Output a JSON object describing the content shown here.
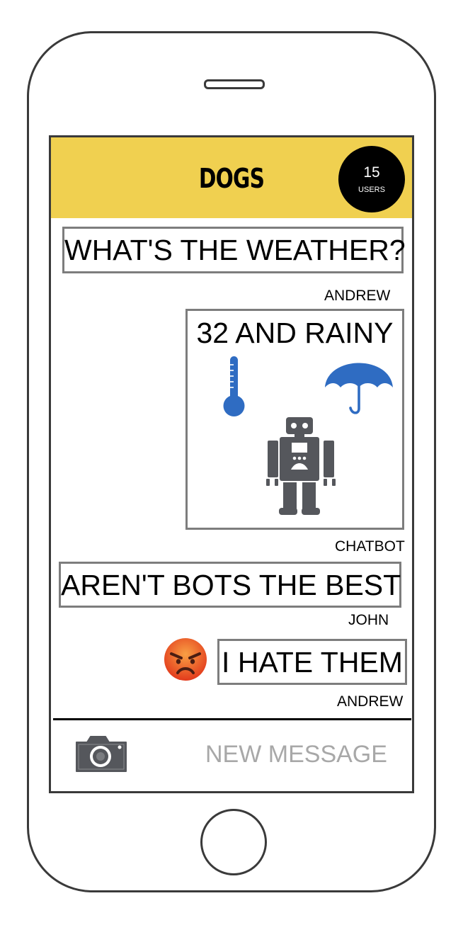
{
  "header": {
    "title": "DOGS",
    "users_count": "15",
    "users_label": "USERS",
    "background_color": "#f0d050"
  },
  "messages": [
    {
      "text": "WHAT'S THE WEATHER?",
      "sender": "ANDREW"
    },
    {
      "text": "32 AND RAINY",
      "sender": "CHATBOT",
      "icons": [
        "thermometer-icon",
        "umbrella-icon",
        "robot-icon"
      ],
      "icon_color": "#2f6cc2"
    },
    {
      "text": "AREN'T BOTS THE BEST",
      "sender": "JOHN"
    },
    {
      "text": "I HATE THEM",
      "sender": "ANDREW",
      "emoji": "angry-face-icon"
    }
  ],
  "composer": {
    "placeholder": "NEW MESSAGE",
    "camera_icon": "camera-icon"
  }
}
